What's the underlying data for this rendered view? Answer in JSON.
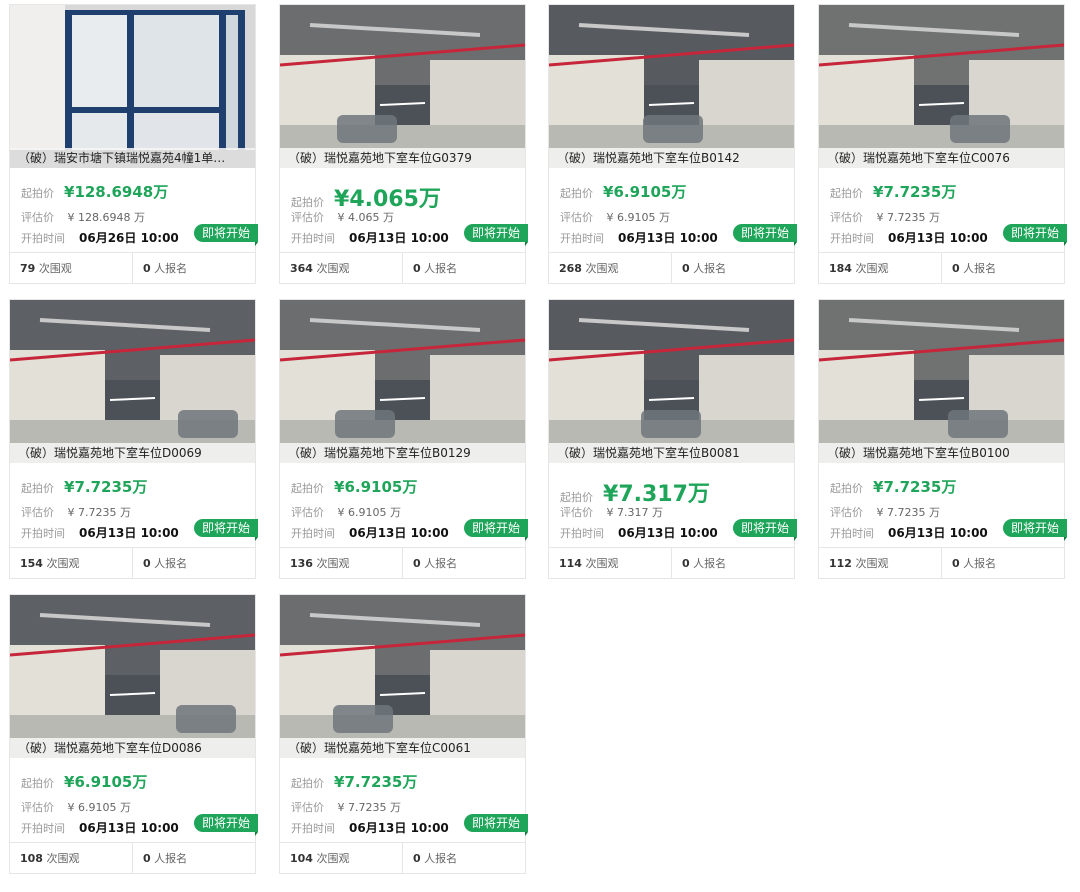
{
  "labels": {
    "start_price": "起拍价",
    "eval_price": "评估价",
    "start_time": "开拍时间",
    "status": "即将开始",
    "views_suffix": "次围观",
    "signups_suffix": "人报名",
    "currency": "¥",
    "unit": "万"
  },
  "colors": {
    "accent": "#1fa55a",
    "photo_strip": "#f5f5f5"
  },
  "lots": [
    {
      "title": "（破）瑞安市塘下镇瑞悦嘉苑4幢1单…",
      "start_price": "128.6948",
      "eval_price": "128.6948",
      "start_time": "06月26日 10:00",
      "views": "79",
      "signups": "0",
      "price_style": "normal",
      "photo": "window-room-photo"
    },
    {
      "title": "（破）瑞悦嘉苑地下室车位G0379",
      "start_price": "4.065",
      "eval_price": "4.065",
      "start_time": "06月13日 10:00",
      "views": "364",
      "signups": "0",
      "price_style": "big",
      "photo": "garage-photo"
    },
    {
      "title": "（破）瑞悦嘉苑地下室车位B0142",
      "start_price": "6.9105",
      "eval_price": "6.9105",
      "start_time": "06月13日 10:00",
      "views": "268",
      "signups": "0",
      "price_style": "normal",
      "photo": "garage-photo"
    },
    {
      "title": "（破）瑞悦嘉苑地下室车位C0076",
      "start_price": "7.7235",
      "eval_price": "7.7235",
      "start_time": "06月13日 10:00",
      "views": "184",
      "signups": "0",
      "price_style": "normal",
      "photo": "garage-photo"
    },
    {
      "title": "（破）瑞悦嘉苑地下室车位D0069",
      "start_price": "7.7235",
      "eval_price": "7.7235",
      "start_time": "06月13日 10:00",
      "views": "154",
      "signups": "0",
      "price_style": "normal",
      "photo": "garage-photo"
    },
    {
      "title": "（破）瑞悦嘉苑地下室车位B0129",
      "start_price": "6.9105",
      "eval_price": "6.9105",
      "start_time": "06月13日 10:00",
      "views": "136",
      "signups": "0",
      "price_style": "normal",
      "photo": "garage-photo"
    },
    {
      "title": "（破）瑞悦嘉苑地下室车位B0081",
      "start_price": "7.317",
      "eval_price": "7.317",
      "start_time": "06月13日 10:00",
      "views": "114",
      "signups": "0",
      "price_style": "big",
      "photo": "garage-photo"
    },
    {
      "title": "（破）瑞悦嘉苑地下室车位B0100",
      "start_price": "7.7235",
      "eval_price": "7.7235",
      "start_time": "06月13日 10:00",
      "views": "112",
      "signups": "0",
      "price_style": "normal",
      "photo": "garage-photo"
    },
    {
      "title": "（破）瑞悦嘉苑地下室车位D0086",
      "start_price": "6.9105",
      "eval_price": "6.9105",
      "start_time": "06月13日 10:00",
      "views": "108",
      "signups": "0",
      "price_style": "normal",
      "photo": "garage-photo"
    },
    {
      "title": "（破）瑞悦嘉苑地下室车位C0061",
      "start_price": "7.7235",
      "eval_price": "7.7235",
      "start_time": "06月13日 10:00",
      "views": "104",
      "signups": "0",
      "price_style": "normal",
      "photo": "garage-photo"
    }
  ]
}
